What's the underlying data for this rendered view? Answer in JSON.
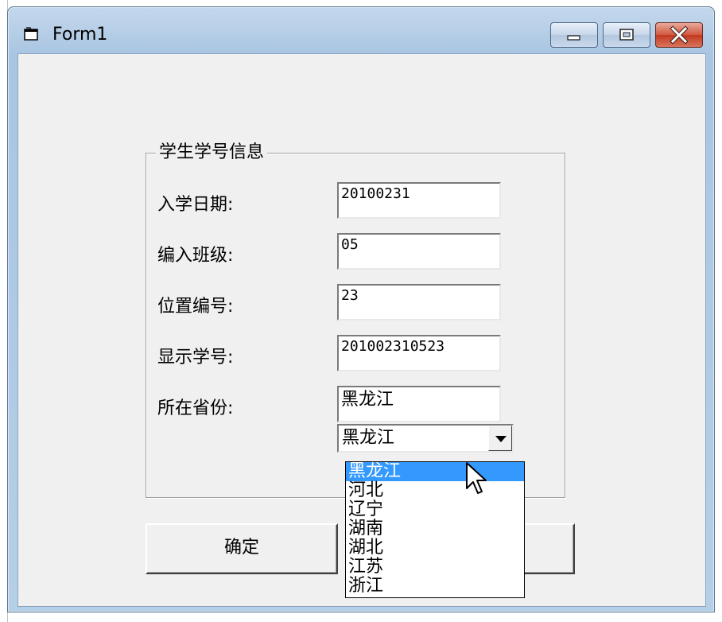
{
  "window": {
    "title": "Form1",
    "icon": "form-app-icon",
    "controls": [
      "minimize-icon",
      "maximize-icon",
      "close-icon"
    ]
  },
  "frame": {
    "title": "学生学号信息",
    "fields": [
      {
        "label": "入学日期:",
        "value": "20100231"
      },
      {
        "label": "编入班级:",
        "value": "05"
      },
      {
        "label": "位置编号:",
        "value": "23"
      },
      {
        "label": "显示学号:",
        "value": "201002310523"
      },
      {
        "label": "所在省份:",
        "value": "黑龙江"
      }
    ]
  },
  "combo": {
    "selected": "黑龙江",
    "options": [
      "黑龙江",
      "河北",
      "辽宁",
      "湖南",
      "湖北",
      "江苏",
      "浙江"
    ],
    "highlighted_index": 0
  },
  "buttons": {
    "ok_label": "确定"
  },
  "colors": {
    "highlight": "#3399ff",
    "client_bg": "#f0f0f0",
    "close_red": "#c2381f"
  }
}
